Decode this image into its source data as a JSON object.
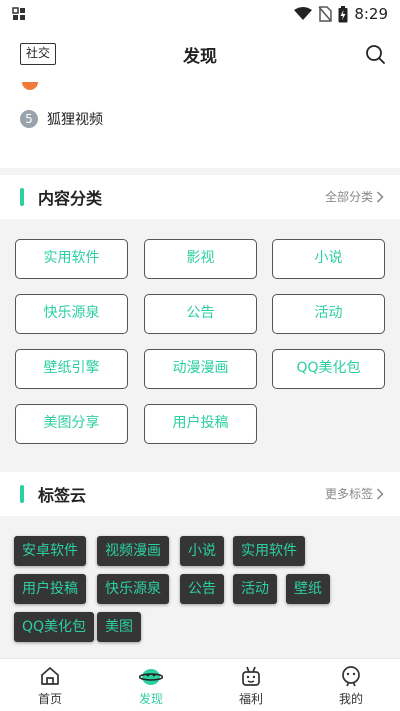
{
  "status_bar": {
    "time": "8:29"
  },
  "header": {
    "social_label": "社交",
    "title": "发现"
  },
  "ranking": {
    "items": [
      {
        "num": "5",
        "label": "狐狸视频"
      }
    ]
  },
  "categories": {
    "title": "内容分类",
    "more": "全部分类",
    "items": [
      "实用软件",
      "影视",
      "小说",
      "快乐源泉",
      "公告",
      "活动",
      "壁纸引擎",
      "动漫漫画",
      "QQ美化包",
      "美图分享",
      "用户投稿"
    ]
  },
  "tag_cloud": {
    "title": "标签云",
    "more": "更多标签",
    "tags": [
      "安卓软件",
      "视频漫画",
      "小说",
      "实用软件",
      "用户投稿",
      "快乐源泉",
      "公告",
      "活动",
      "壁纸",
      "QQ美化包",
      "美图"
    ]
  },
  "bottom_nav": {
    "items": [
      {
        "label": "首页",
        "icon": "home-icon"
      },
      {
        "label": "发现",
        "icon": "discover-icon",
        "active": true
      },
      {
        "label": "福利",
        "icon": "gift-icon"
      },
      {
        "label": "我的",
        "icon": "profile-icon"
      }
    ]
  },
  "colors": {
    "accent": "#2ccfa0",
    "tag_bg": "#353535",
    "rank_dot": "#f07a3a"
  }
}
